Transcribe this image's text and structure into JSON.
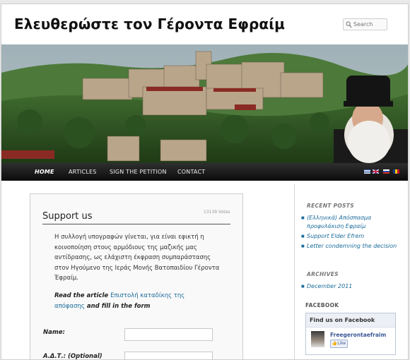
{
  "site": {
    "title": "Ελευθερώστε τον Γέροντα Εφραίμ"
  },
  "search": {
    "placeholder": "Search",
    "icon": "search-icon"
  },
  "nav": {
    "items": [
      {
        "label": "HOME",
        "active": true
      },
      {
        "label": "ARTICLES",
        "active": false
      },
      {
        "label": "SIGN THE PETITION",
        "active": false
      },
      {
        "label": "CONTACT",
        "active": false
      }
    ],
    "flags": [
      "greek-flag-icon",
      "uk-flag-icon",
      "russian-flag-icon",
      "romanian-flag-icon"
    ]
  },
  "petition": {
    "title": "Support us",
    "votes": "13139 Votes",
    "intro": "Η συλλογή υπογραφών γίνεται, για είναι εφικτή η κοινοποίηση στους αρμόδιους της μαζικής μας αντίδρασης, ως ελάχιστη έκφραση συμπαράστασης στον Ηγούμενο της Ιεράς Μονής Βατοπαιδίου Γέροντα Έφραίμ.",
    "read_prefix": "Read the article",
    "read_link": "Επιστολή καταδίκης της απόφασης",
    "read_suffix": "and fill in the form",
    "fields": [
      {
        "label": "Name:",
        "optional": ""
      },
      {
        "label": "Α.Δ.Τ.:",
        "optional": "(Optional)"
      }
    ]
  },
  "sidebar": {
    "recent_title": "RECENT POSTS",
    "recent": [
      "(Ελληνικά) Απόσπασμα προφυλάκιση Εφραίμ",
      "Support Elder Efrem",
      "Letter condemning the decision"
    ],
    "archives_title": "ARCHIVES",
    "archives": [
      "December 2011"
    ],
    "facebook_title": "FACEBOOK"
  },
  "facebook": {
    "header": "Find us on Facebook",
    "page_name": "Freegerontaefraim",
    "like": "Like"
  },
  "colors": {
    "link": "#1b6c9a",
    "nav_bg": "#111111",
    "accent": "#3b5998"
  }
}
